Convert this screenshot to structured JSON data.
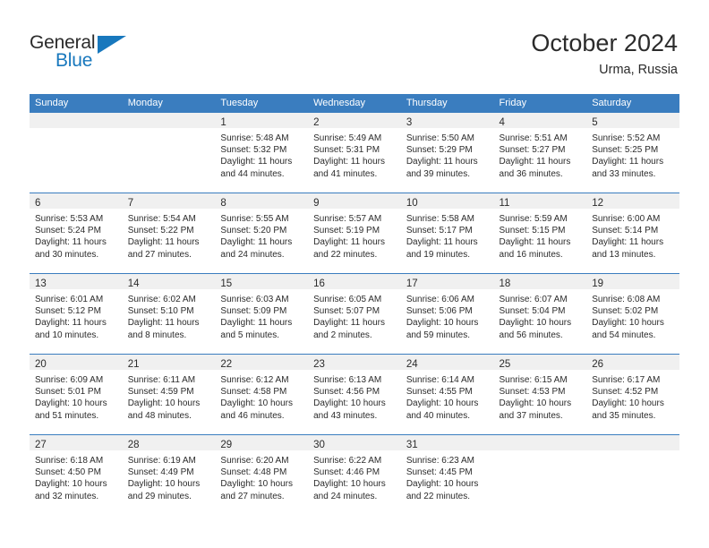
{
  "brand": {
    "name_top": "General",
    "name_bottom": "Blue",
    "accent_color": "#1878bd",
    "logo_icon": "triangle-icon"
  },
  "header": {
    "title": "October 2024",
    "location": "Urma, Russia"
  },
  "colors": {
    "header_blue": "#3a7dbf",
    "daynum_band": "#f0f0f0",
    "text": "#2b2b2b"
  },
  "weekdays": [
    "Sunday",
    "Monday",
    "Tuesday",
    "Wednesday",
    "Thursday",
    "Friday",
    "Saturday"
  ],
  "labels": {
    "sunrise_prefix": "Sunrise:",
    "sunset_prefix": "Sunset:",
    "daylight_prefix": "Daylight:"
  },
  "weeks": [
    [
      {
        "day": "",
        "lines": []
      },
      {
        "day": "",
        "lines": []
      },
      {
        "day": "1",
        "lines": [
          "Sunrise: 5:48 AM",
          "Sunset: 5:32 PM",
          "Daylight: 11 hours and 44 minutes."
        ]
      },
      {
        "day": "2",
        "lines": [
          "Sunrise: 5:49 AM",
          "Sunset: 5:31 PM",
          "Daylight: 11 hours and 41 minutes."
        ]
      },
      {
        "day": "3",
        "lines": [
          "Sunrise: 5:50 AM",
          "Sunset: 5:29 PM",
          "Daylight: 11 hours and 39 minutes."
        ]
      },
      {
        "day": "4",
        "lines": [
          "Sunrise: 5:51 AM",
          "Sunset: 5:27 PM",
          "Daylight: 11 hours and 36 minutes."
        ]
      },
      {
        "day": "5",
        "lines": [
          "Sunrise: 5:52 AM",
          "Sunset: 5:25 PM",
          "Daylight: 11 hours and 33 minutes."
        ]
      }
    ],
    [
      {
        "day": "6",
        "lines": [
          "Sunrise: 5:53 AM",
          "Sunset: 5:24 PM",
          "Daylight: 11 hours and 30 minutes."
        ]
      },
      {
        "day": "7",
        "lines": [
          "Sunrise: 5:54 AM",
          "Sunset: 5:22 PM",
          "Daylight: 11 hours and 27 minutes."
        ]
      },
      {
        "day": "8",
        "lines": [
          "Sunrise: 5:55 AM",
          "Sunset: 5:20 PM",
          "Daylight: 11 hours and 24 minutes."
        ]
      },
      {
        "day": "9",
        "lines": [
          "Sunrise: 5:57 AM",
          "Sunset: 5:19 PM",
          "Daylight: 11 hours and 22 minutes."
        ]
      },
      {
        "day": "10",
        "lines": [
          "Sunrise: 5:58 AM",
          "Sunset: 5:17 PM",
          "Daylight: 11 hours and 19 minutes."
        ]
      },
      {
        "day": "11",
        "lines": [
          "Sunrise: 5:59 AM",
          "Sunset: 5:15 PM",
          "Daylight: 11 hours and 16 minutes."
        ]
      },
      {
        "day": "12",
        "lines": [
          "Sunrise: 6:00 AM",
          "Sunset: 5:14 PM",
          "Daylight: 11 hours and 13 minutes."
        ]
      }
    ],
    [
      {
        "day": "13",
        "lines": [
          "Sunrise: 6:01 AM",
          "Sunset: 5:12 PM",
          "Daylight: 11 hours and 10 minutes."
        ]
      },
      {
        "day": "14",
        "lines": [
          "Sunrise: 6:02 AM",
          "Sunset: 5:10 PM",
          "Daylight: 11 hours and 8 minutes."
        ]
      },
      {
        "day": "15",
        "lines": [
          "Sunrise: 6:03 AM",
          "Sunset: 5:09 PM",
          "Daylight: 11 hours and 5 minutes."
        ]
      },
      {
        "day": "16",
        "lines": [
          "Sunrise: 6:05 AM",
          "Sunset: 5:07 PM",
          "Daylight: 11 hours and 2 minutes."
        ]
      },
      {
        "day": "17",
        "lines": [
          "Sunrise: 6:06 AM",
          "Sunset: 5:06 PM",
          "Daylight: 10 hours and 59 minutes."
        ]
      },
      {
        "day": "18",
        "lines": [
          "Sunrise: 6:07 AM",
          "Sunset: 5:04 PM",
          "Daylight: 10 hours and 56 minutes."
        ]
      },
      {
        "day": "19",
        "lines": [
          "Sunrise: 6:08 AM",
          "Sunset: 5:02 PM",
          "Daylight: 10 hours and 54 minutes."
        ]
      }
    ],
    [
      {
        "day": "20",
        "lines": [
          "Sunrise: 6:09 AM",
          "Sunset: 5:01 PM",
          "Daylight: 10 hours and 51 minutes."
        ]
      },
      {
        "day": "21",
        "lines": [
          "Sunrise: 6:11 AM",
          "Sunset: 4:59 PM",
          "Daylight: 10 hours and 48 minutes."
        ]
      },
      {
        "day": "22",
        "lines": [
          "Sunrise: 6:12 AM",
          "Sunset: 4:58 PM",
          "Daylight: 10 hours and 46 minutes."
        ]
      },
      {
        "day": "23",
        "lines": [
          "Sunrise: 6:13 AM",
          "Sunset: 4:56 PM",
          "Daylight: 10 hours and 43 minutes."
        ]
      },
      {
        "day": "24",
        "lines": [
          "Sunrise: 6:14 AM",
          "Sunset: 4:55 PM",
          "Daylight: 10 hours and 40 minutes."
        ]
      },
      {
        "day": "25",
        "lines": [
          "Sunrise: 6:15 AM",
          "Sunset: 4:53 PM",
          "Daylight: 10 hours and 37 minutes."
        ]
      },
      {
        "day": "26",
        "lines": [
          "Sunrise: 6:17 AM",
          "Sunset: 4:52 PM",
          "Daylight: 10 hours and 35 minutes."
        ]
      }
    ],
    [
      {
        "day": "27",
        "lines": [
          "Sunrise: 6:18 AM",
          "Sunset: 4:50 PM",
          "Daylight: 10 hours and 32 minutes."
        ]
      },
      {
        "day": "28",
        "lines": [
          "Sunrise: 6:19 AM",
          "Sunset: 4:49 PM",
          "Daylight: 10 hours and 29 minutes."
        ]
      },
      {
        "day": "29",
        "lines": [
          "Sunrise: 6:20 AM",
          "Sunset: 4:48 PM",
          "Daylight: 10 hours and 27 minutes."
        ]
      },
      {
        "day": "30",
        "lines": [
          "Sunrise: 6:22 AM",
          "Sunset: 4:46 PM",
          "Daylight: 10 hours and 24 minutes."
        ]
      },
      {
        "day": "31",
        "lines": [
          "Sunrise: 6:23 AM",
          "Sunset: 4:45 PM",
          "Daylight: 10 hours and 22 minutes."
        ]
      },
      {
        "day": "",
        "lines": []
      },
      {
        "day": "",
        "lines": []
      }
    ]
  ]
}
